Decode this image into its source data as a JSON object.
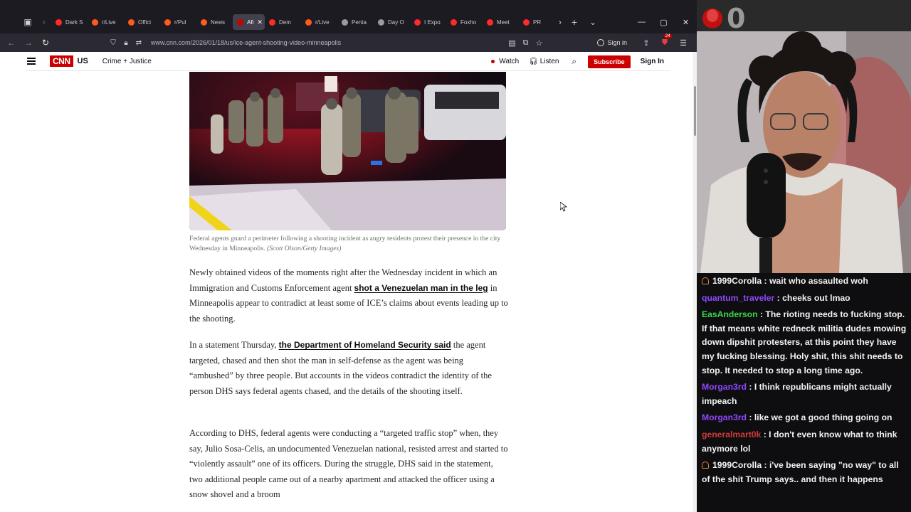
{
  "browser": {
    "tabs": [
      {
        "title": "Dark S",
        "fav_color": "#ff2a2a"
      },
      {
        "title": "r/Live",
        "fav_color": "#ff5a1e"
      },
      {
        "title": "Offici",
        "fav_color": "#ff5a1e"
      },
      {
        "title": "r/Pul",
        "fav_color": "#ff5a1e"
      },
      {
        "title": "News",
        "fav_color": "#ff5a1e"
      },
      {
        "title": "Afi",
        "fav_color": "#cc0000",
        "active": true
      },
      {
        "title": "Dem",
        "fav_color": "#ff2a2a"
      },
      {
        "title": "r/Live",
        "fav_color": "#ff5a1e"
      },
      {
        "title": "Penta",
        "fav_color": "#9a9aa6"
      },
      {
        "title": "Day O",
        "fav_color": "#9a9aa6"
      },
      {
        "title": "I Expo",
        "fav_color": "#ff2a2a"
      },
      {
        "title": "Foxho",
        "fav_color": "#ff2a2a"
      },
      {
        "title": "Meet",
        "fav_color": "#ff2a2a"
      },
      {
        "title": "PR",
        "fav_color": "#ff2a2a"
      }
    ],
    "url": "www.cnn.com/2026/01/18/us/ice-agent-shooting-video-minneapolis",
    "sign_in": "Sign in",
    "extension_badge": "24"
  },
  "cnn": {
    "logo": "CNN",
    "section": "US",
    "subsection": "Crime + Justice",
    "watch": "Watch",
    "listen": "Listen",
    "subscribe": "Subscribe",
    "sign_in": "Sign In"
  },
  "article": {
    "caption": "Federal agents guard a perimeter following a shooting incident as angry residents protest their presence in the city Wednesday in Minneapolis.",
    "credit": "(Scott Olson/Getty Images)",
    "p1_before": "Newly obtained videos of the moments right after the Wednesday incident in which an Immigration and Customs Enforcement agent ",
    "p1_link": "shot a Venezuelan man in the leg",
    "p1_after": " in Minneapolis appear to contradict at least some of ICE’s claims about events leading up to the shooting.",
    "p2_before": "In a statement Thursday, ",
    "p2_link": "the Department of Homeland Security said",
    "p2_after": " the agent targeted, chased and then shot the man in self-defense as the agent was being “ambushed” by three people. But accounts in the videos contradict the identity of the person DHS says federal agents chased, and the details of the shooting itself.",
    "p3": "According to DHS, federal agents were conducting a “targeted traffic stop” when, they say, Julio Sosa-Celis, an undocumented Venezuelan national, resisted arrest and started to “violently assault” one of its officers. During the struggle, DHS said in the statement, two additional people came out of a nearby apartment and attacked the officer using a snow shovel and a broom"
  },
  "stream": {
    "counter": "0",
    "chat": [
      {
        "user": "1999Corolla",
        "color": "#f2f2f2",
        "icon": true,
        "text": "wait who assaulted woh"
      },
      {
        "user": "quantum_traveler",
        "color": "#9146ff",
        "icon": false,
        "text": "cheeks out lmao"
      },
      {
        "user": "EasAnderson",
        "color": "#38d84a",
        "icon": false,
        "text": "The rioting needs to fucking stop. If that means white redneck militia dudes mowing down dipshit protesters, at this point they have my fucking blessing. Holy shit, this shit needs to stop. It needed to stop a long time ago."
      },
      {
        "user": "Morgan3rd",
        "color": "#9146ff",
        "icon": false,
        "text": "I think republicans might actually impeach"
      },
      {
        "user": "Morgan3rd",
        "color": "#9146ff",
        "icon": false,
        "text": "like we got a good thing going on"
      },
      {
        "user": "generalmart0k",
        "color": "#d23a3a",
        "icon": false,
        "text": "I don't even know what to think anymore lol"
      },
      {
        "user": "1999Corolla",
        "color": "#f2f2f2",
        "icon": true,
        "text": "i've been saying \"no way\" to all of the shit Trump says.. and then it happens"
      }
    ]
  }
}
